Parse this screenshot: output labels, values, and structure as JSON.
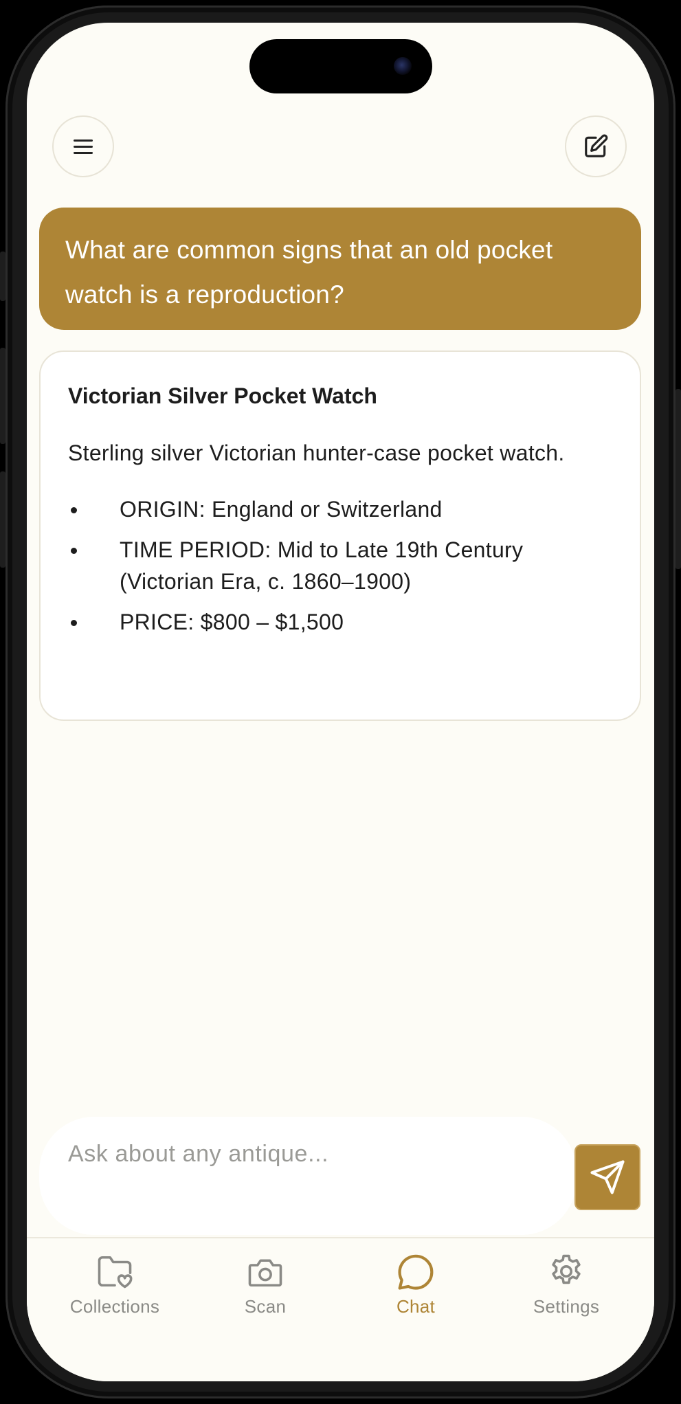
{
  "header": {
    "menu_icon": "menu-icon",
    "compose_icon": "compose-icon"
  },
  "chat": {
    "user_message": "What are common signs that an old pocket watch is a reproduction?",
    "answer": {
      "title": "Victorian Silver Pocket Watch",
      "description": "Sterling silver Victorian hunter-case pocket watch.",
      "bullets": [
        "ORIGIN: England or Switzerland",
        "TIME PERIOD: Mid to Late 19th Century (Victorian Era, c. 1860–1900)",
        "PRICE: $800 – $1,500"
      ]
    }
  },
  "composer": {
    "placeholder": "Ask about any antique...",
    "value": "",
    "send_icon": "send-icon"
  },
  "tabs": [
    {
      "label": "Collections",
      "icon": "folder-heart-icon",
      "active": false
    },
    {
      "label": "Scan",
      "icon": "camera-icon",
      "active": false
    },
    {
      "label": "Chat",
      "icon": "chat-bubble-icon",
      "active": true
    },
    {
      "label": "Settings",
      "icon": "gear-icon",
      "active": false
    }
  ],
  "colors": {
    "accent": "#ae8536",
    "background": "#fdfcf6",
    "card": "#ffffff",
    "text": "#1d1d1d",
    "muted": "#8a8a86"
  }
}
